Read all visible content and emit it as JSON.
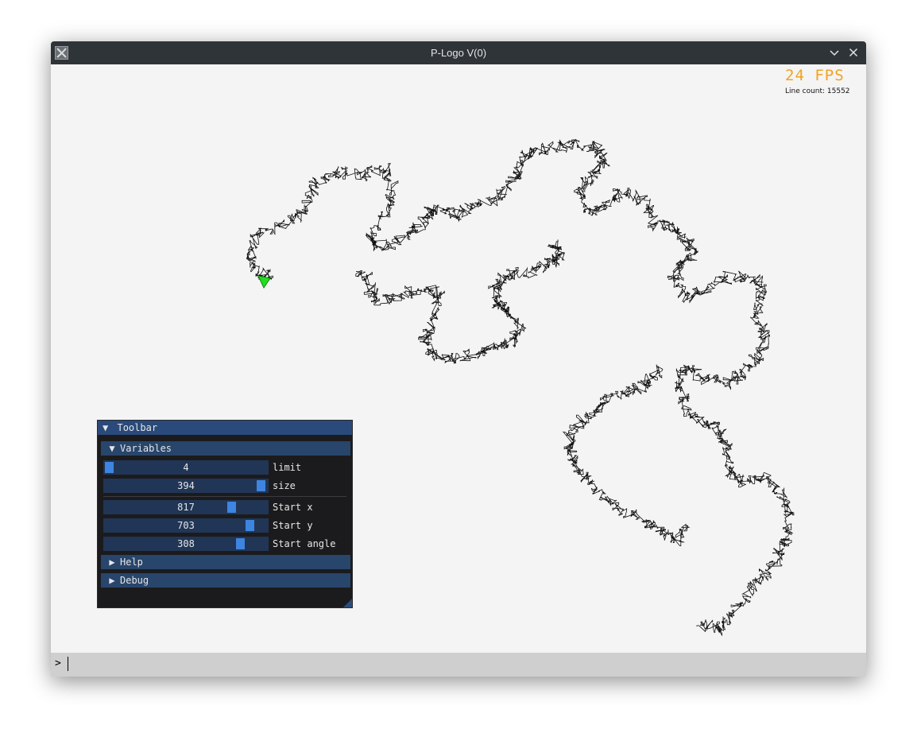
{
  "window": {
    "title": "P-Logo V(0)",
    "minimize_glyph": "⌄",
    "close_glyph": "✕",
    "app_icon": "x11-app-icon"
  },
  "hud": {
    "fps": "24 FPS",
    "line_count": "Line count: 15552",
    "fps_color": "#f2a21f"
  },
  "turtle": {
    "icon": "turtle-arrow-icon",
    "color": "#22dd22"
  },
  "toolbar": {
    "header": "Toolbar",
    "header_arrow": "▼",
    "variables": {
      "label": "Variables",
      "arrow": "▼",
      "limit": {
        "value": "4",
        "label": "limit",
        "fraction": 0.0
      },
      "size": {
        "value": "394",
        "label": "size",
        "fraction": 1.0
      },
      "start_x": {
        "value": "817",
        "label": "Start x",
        "fraction": 0.82
      },
      "start_y": {
        "value": "703",
        "label": "Start y",
        "fraction": 0.9
      },
      "start_angle": {
        "value": "308",
        "label": "Start angle",
        "fraction": 0.86
      }
    },
    "help": {
      "label": "Help",
      "arrow": "▶"
    },
    "debug": {
      "label": "Debug",
      "arrow": "▶"
    },
    "accent_color": "#3d85e0"
  },
  "command": {
    "prompt": ">",
    "value": ""
  }
}
